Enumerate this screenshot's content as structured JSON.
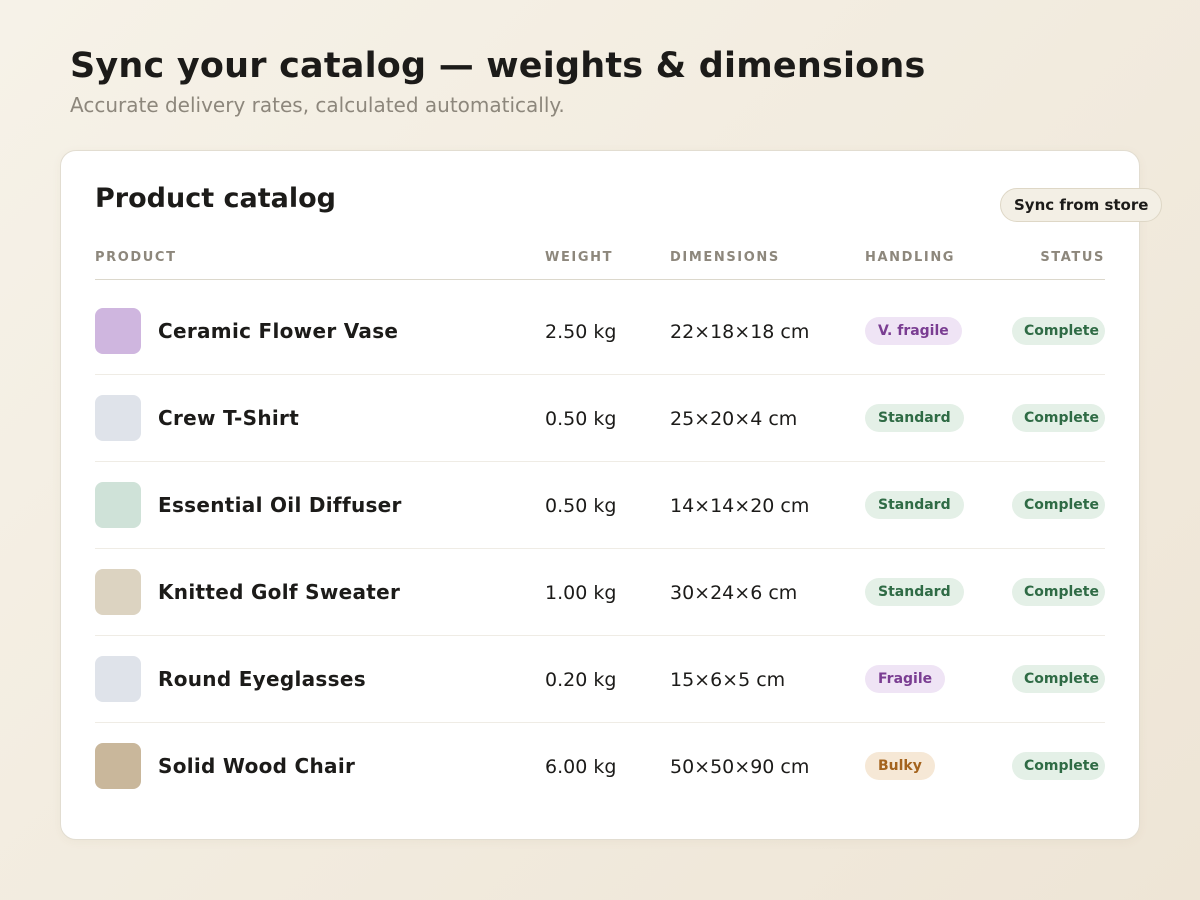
{
  "header": {
    "title": "Sync your catalog — weights & dimensions",
    "subtitle": "Accurate delivery rates, calculated automatically."
  },
  "catalog": {
    "title": "Product catalog",
    "sync_label": "Sync from store",
    "columns": {
      "product": "PRODUCT",
      "weight": "WEIGHT",
      "dimensions": "DIMENSIONS",
      "handling": "HANDLING",
      "status": "STATUS"
    },
    "rows": [
      {
        "name": "Ceramic Flower Vase",
        "weight": "2.50 kg",
        "dimensions": "22×18×18 cm",
        "handling": "V. fragile",
        "handling_kind": "fragile",
        "status": "Complete",
        "swatch": "#cfb6df"
      },
      {
        "name": "Crew T-Shirt",
        "weight": "0.50 kg",
        "dimensions": "25×20×4 cm",
        "handling": "Standard",
        "handling_kind": "standard",
        "status": "Complete",
        "swatch": "#dfe3ea"
      },
      {
        "name": "Essential Oil Diffuser",
        "weight": "0.50 kg",
        "dimensions": "14×14×20 cm",
        "handling": "Standard",
        "handling_kind": "standard",
        "status": "Complete",
        "swatch": "#cfe2d8"
      },
      {
        "name": "Knitted Golf Sweater",
        "weight": "1.00 kg",
        "dimensions": "30×24×6 cm",
        "handling": "Standard",
        "handling_kind": "standard",
        "status": "Complete",
        "swatch": "#dcd3c1"
      },
      {
        "name": "Round Eyeglasses",
        "weight": "0.20 kg",
        "dimensions": "15×6×5 cm",
        "handling": "Fragile",
        "handling_kind": "fragile",
        "status": "Complete",
        "swatch": "#dfe3ea"
      },
      {
        "name": "Solid Wood Chair",
        "weight": "6.00 kg",
        "dimensions": "50×50×90 cm",
        "handling": "Bulky",
        "handling_kind": "bulky",
        "status": "Complete",
        "swatch": "#c9b79b"
      }
    ]
  },
  "colors": {
    "standard_bg": "#e4f0e7",
    "standard_text": "#2f6b45",
    "fragile_bg": "#efe4f5",
    "fragile_text": "#7a3d92",
    "bulky_bg": "#f6e8d6",
    "bulky_text": "#a4631d",
    "complete_bg": "#e4f0e7",
    "complete_text": "#2f6b45"
  }
}
